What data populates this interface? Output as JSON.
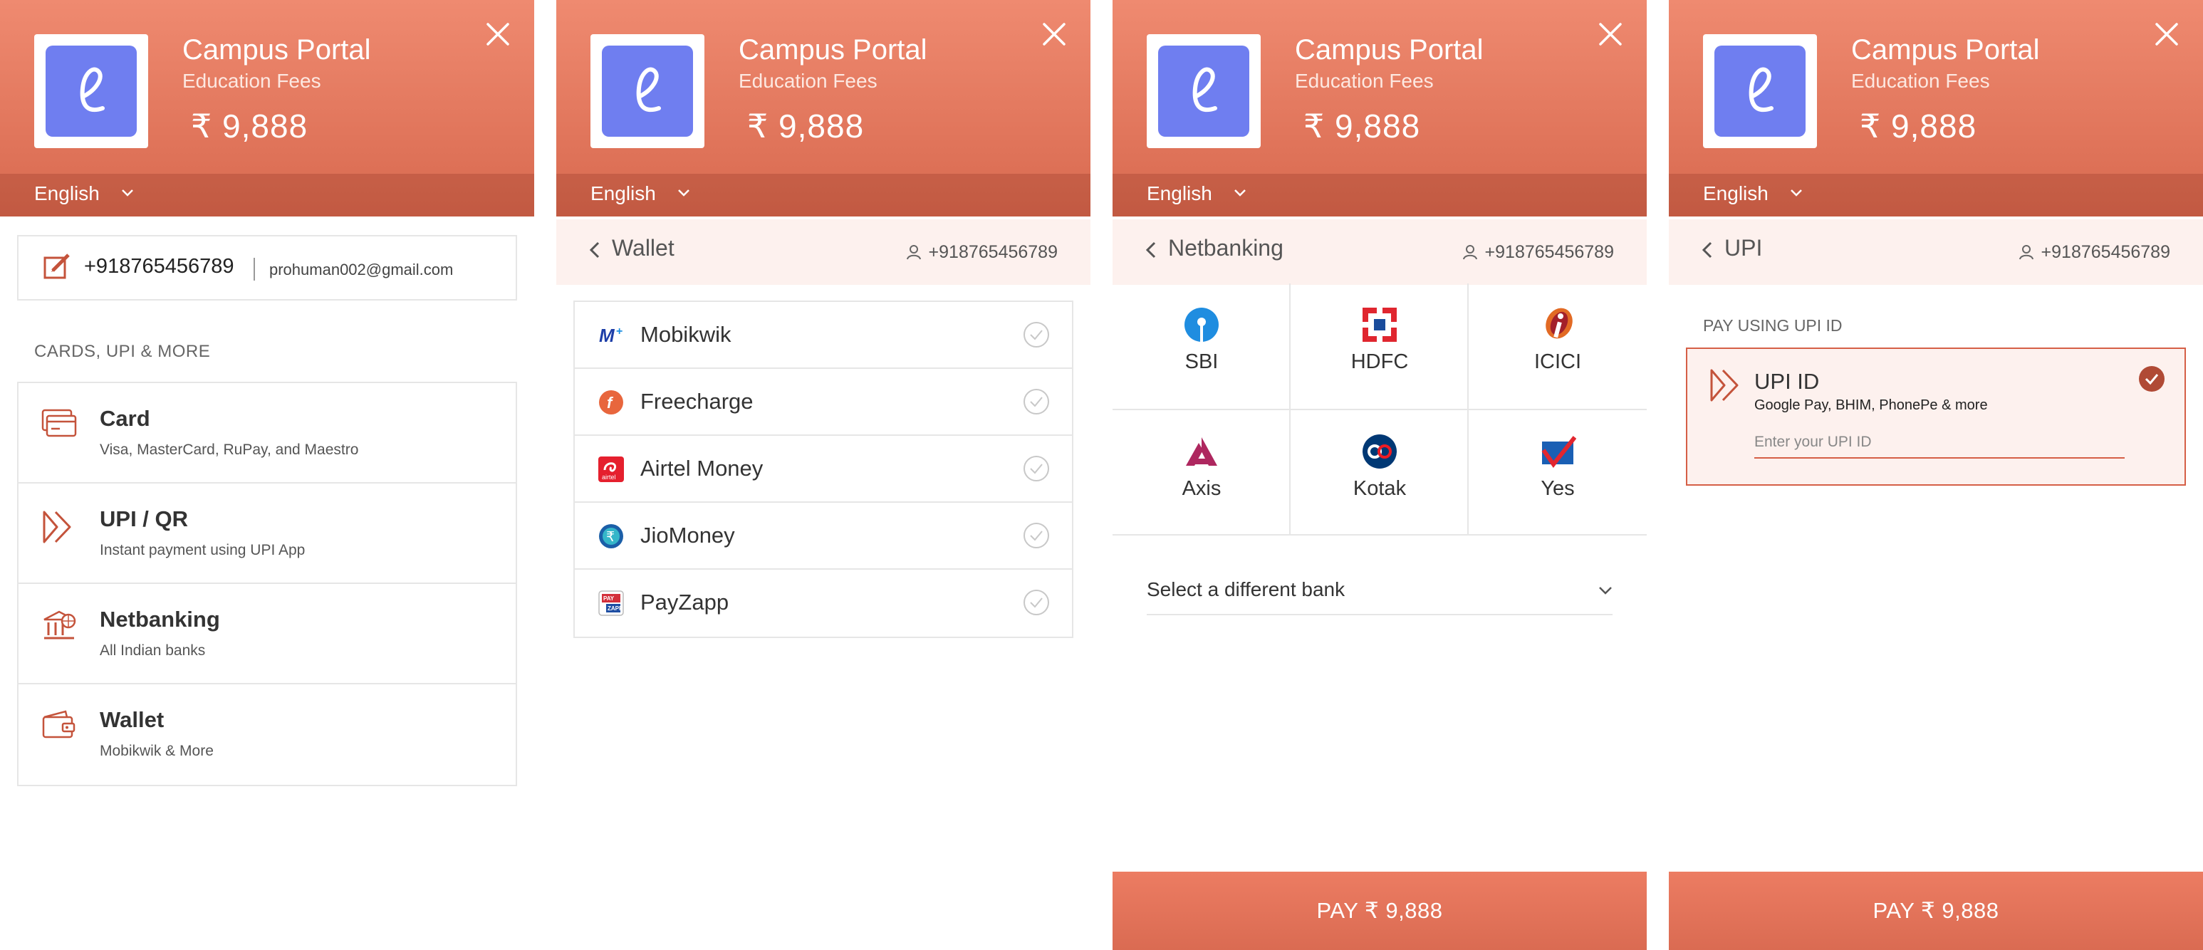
{
  "header": {
    "logo_letter": "e",
    "merchant": "Campus Portal",
    "subtitle": "Education Fees",
    "amount": "₹ 9,888",
    "language": "English"
  },
  "colors": {
    "brand": "#d8694f",
    "logo_bg": "#6f7ef0",
    "selected_border": "#d55f46",
    "check_fill": "#b04a35"
  },
  "panel1": {
    "contact_phone": "+918765456789",
    "contact_email": "prohuman002@gmail.com",
    "section_label": "CARDS, UPI & MORE",
    "methods": [
      {
        "title": "Card",
        "subtitle": "Visa, MasterCard, RuPay, and Maestro",
        "icon": "card-icon"
      },
      {
        "title": "UPI / QR",
        "subtitle": "Instant payment using UPI App",
        "icon": "upi-icon"
      },
      {
        "title": "Netbanking",
        "subtitle": "All Indian banks",
        "icon": "bank-icon"
      },
      {
        "title": "Wallet",
        "subtitle": "Mobikwik & More",
        "icon": "wallet-icon"
      }
    ]
  },
  "panel2": {
    "title": "Wallet",
    "phone": "+918765456789",
    "wallets": [
      {
        "name": "Mobikwik",
        "icon": "mobikwik-icon"
      },
      {
        "name": "Freecharge",
        "icon": "freecharge-icon"
      },
      {
        "name": "Airtel Money",
        "icon": "airtel-icon"
      },
      {
        "name": "JioMoney",
        "icon": "jiomoney-icon"
      },
      {
        "name": "PayZapp",
        "icon": "payzapp-icon"
      }
    ]
  },
  "panel3": {
    "title": "Netbanking",
    "phone": "+918765456789",
    "banks": [
      "SBI",
      "HDFC",
      "ICICI",
      "Axis",
      "Kotak",
      "Yes"
    ],
    "select_label": "Select a different bank",
    "pay_label": "PAY ₹ 9,888"
  },
  "panel4": {
    "title": "UPI",
    "phone": "+918765456789",
    "section_label": "PAY USING UPI ID",
    "upi_title": "UPI ID",
    "upi_subtitle": "Google Pay, BHIM, PhonePe & more",
    "upi_placeholder": "Enter your UPI ID",
    "pay_label": "PAY ₹ 9,888"
  }
}
